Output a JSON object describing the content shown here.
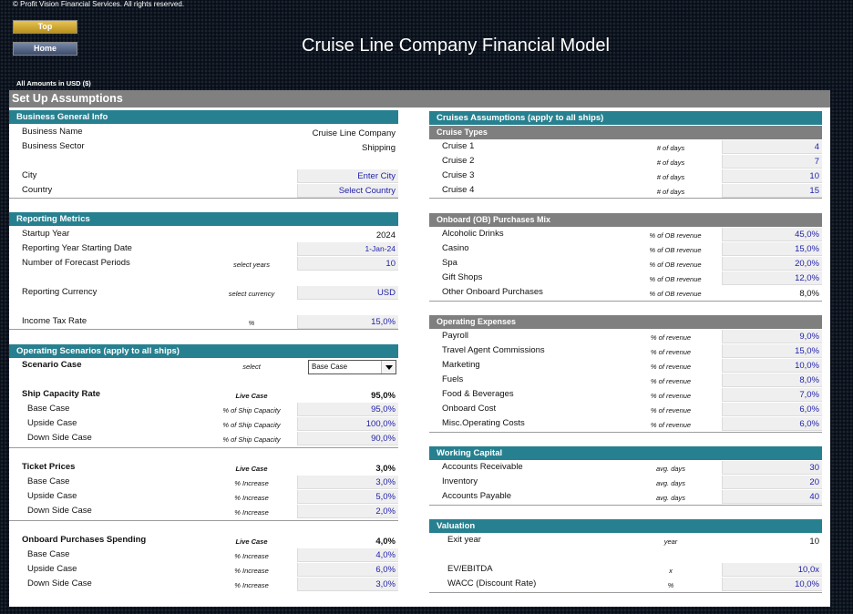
{
  "copyright": "© Profit Vision Financial Services. All rights reserved.",
  "nav": {
    "top": "Top",
    "home": "Home"
  },
  "title": "Cruise Line Company Financial Model",
  "amounts_note": "All Amounts in  USD ($)",
  "setup_title": "Set Up Assumptions",
  "general": {
    "header": "Business General Info",
    "rows": [
      {
        "label": "Business Name",
        "value": "Cruise Line Company"
      },
      {
        "label": "Business Sector",
        "value": "Shipping"
      },
      {
        "label": "City",
        "value": "Enter City"
      },
      {
        "label": "Country",
        "value": "Select Country"
      }
    ]
  },
  "reporting": {
    "header": "Reporting Metrics",
    "rows": [
      {
        "label": "Startup Year",
        "unit": "",
        "value": "2024"
      },
      {
        "label": "Reporting Year Starting Date",
        "unit": "",
        "value": "1-Jan-24"
      },
      {
        "label": "Number of Forecast Periods",
        "unit": "select years",
        "value": "10"
      },
      {
        "label": "Reporting Currency",
        "unit": "select currency",
        "value": "USD"
      },
      {
        "label": "Income Tax Rate",
        "unit": "%",
        "value": "15,0%"
      }
    ]
  },
  "scenarios": {
    "header": "Operating Scenarios (apply to all ships)",
    "scenario_case": {
      "label": "Scenario Case",
      "unit": "select",
      "value": "Base Case"
    },
    "groups": [
      {
        "label": "Ship Capacity Rate",
        "unit": "Live Case",
        "value": "95,0%",
        "rows": [
          {
            "label": "Base Case",
            "unit": "% of Ship Capacity",
            "value": "95,0%"
          },
          {
            "label": "Upside Case",
            "unit": "% of Ship Capacity",
            "value": "100,0%"
          },
          {
            "label": "Down Side Case",
            "unit": "% of Ship Capacity",
            "value": "90,0%"
          }
        ]
      },
      {
        "label": "Ticket Prices",
        "unit": "Live Case",
        "value": "3,0%",
        "rows": [
          {
            "label": "Base Case",
            "unit": "% Increase",
            "value": "3,0%"
          },
          {
            "label": "Upside Case",
            "unit": "% Increase",
            "value": "5,0%"
          },
          {
            "label": "Down Side Case",
            "unit": "% Increase",
            "value": "2,0%"
          }
        ]
      },
      {
        "label": "Onboard Purchases Spending",
        "unit": "Live Case",
        "value": "4,0%",
        "rows": [
          {
            "label": "Base Case",
            "unit": "% Increase",
            "value": "4,0%"
          },
          {
            "label": "Upside Case",
            "unit": "% Increase",
            "value": "6,0%"
          },
          {
            "label": "Down Side Case",
            "unit": "% Increase",
            "value": "3,0%"
          }
        ]
      }
    ]
  },
  "cruises": {
    "header": "Cruises Assumptions (apply to all ships)",
    "types_header": "Cruise Types",
    "types": [
      {
        "label": "Cruise 1",
        "unit": "# of days",
        "value": "4"
      },
      {
        "label": "Cruise 2",
        "unit": "# of days",
        "value": "7"
      },
      {
        "label": "Cruise 3",
        "unit": "# of days",
        "value": "10"
      },
      {
        "label": "Cruise 4",
        "unit": "# of days",
        "value": "15"
      }
    ],
    "ob_header": "Onboard (OB) Purchases Mix",
    "ob": [
      {
        "label": "Alcoholic Drinks",
        "unit": "% of OB revenue",
        "value": "45,0%"
      },
      {
        "label": "Casino",
        "unit": "% of OB revenue",
        "value": "15,0%"
      },
      {
        "label": "Spa",
        "unit": "% of OB revenue",
        "value": "20,0%"
      },
      {
        "label": "Gift Shops",
        "unit": "% of OB revenue",
        "value": "12,0%"
      },
      {
        "label": "Other Onboard Purchases",
        "unit": "% of OB revenue",
        "value": "8,0%"
      }
    ],
    "opex_header": "Operating Expenses",
    "opex": [
      {
        "label": "Payroll",
        "unit": "% of revenue",
        "value": "9,0%"
      },
      {
        "label": "Travel Agent Commissions",
        "unit": "% of revenue",
        "value": "15,0%"
      },
      {
        "label": "Marketing",
        "unit": "% of revenue",
        "value": "10,0%"
      },
      {
        "label": "Fuels",
        "unit": "% of revenue",
        "value": "8,0%"
      },
      {
        "label": "Food & Beverages",
        "unit": "% of revenue",
        "value": "7,0%"
      },
      {
        "label": "Onboard Cost",
        "unit": "% of revenue",
        "value": "6,0%"
      },
      {
        "label": "Misc.Operating Costs",
        "unit": "% of revenue",
        "value": "6,0%"
      }
    ]
  },
  "working_capital": {
    "header": "Working Capital",
    "rows": [
      {
        "label": "Accounts Receivable",
        "unit": "avg. days",
        "value": "30"
      },
      {
        "label": "Inventory",
        "unit": "avg. days",
        "value": "20"
      },
      {
        "label": "Accounts Payable",
        "unit": "avg. days",
        "value": "40"
      }
    ]
  },
  "valuation": {
    "header": "Valuation",
    "rows": [
      {
        "label": "Exit year",
        "unit": "year",
        "value": "10"
      },
      {
        "label": "EV/EBITDA",
        "unit": "x",
        "value": "10,0x"
      },
      {
        "label": "WACC (Discount Rate)",
        "unit": "%",
        "value": "10,0%"
      }
    ]
  }
}
